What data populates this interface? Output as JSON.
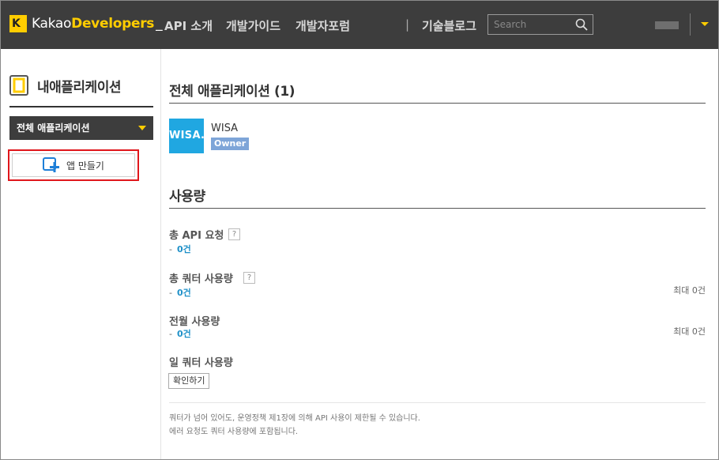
{
  "nav": {
    "logo_k": "K",
    "logo_kakao": "Kakao",
    "logo_developers": "Developers",
    "logo_underscore": "_",
    "links": [
      "API 소개",
      "개발가이드",
      "개발자포럼",
      "기술블로그"
    ],
    "separator": "|",
    "search_placeholder": "Search"
  },
  "sidebar": {
    "title": "내애플리케이션",
    "select_value": "전체 애플리케이션",
    "create_label": "앱 만들기"
  },
  "main": {
    "apps_title": "전체 애플리케이션 (1)",
    "app": {
      "thumb_text": "WISA.",
      "name": "WISA",
      "role": "Owner"
    },
    "usage_title": "사용량",
    "help_glyph": "?",
    "usage": [
      {
        "label": "총 API 요청",
        "prefix": "-",
        "value": "0건",
        "max": ""
      },
      {
        "label": "총 쿼터 사용량",
        "prefix": "-",
        "value": "0건",
        "max": "최대 0건"
      },
      {
        "label": "전월 사용량",
        "prefix": "-",
        "value": "0건",
        "max": "최대 0건"
      },
      {
        "label": "일 쿼터 사용량",
        "button": "확인하기"
      }
    ],
    "notes": [
      "쿼터가 넘어 있어도, 운영정책 제1장에 의해 API 사용이 제한될 수 있습니다.",
      "에러 요청도 쿼터 사용량에 포함됩니다."
    ]
  },
  "colors": {
    "nav_bg": "#3d3d3d",
    "brand_yellow": "#ffcd00",
    "app_thumb": "#20a7e1",
    "owner_badge": "#7ea5d8",
    "value_blue": "#1e90c8",
    "highlight_red": "#e0161b"
  }
}
